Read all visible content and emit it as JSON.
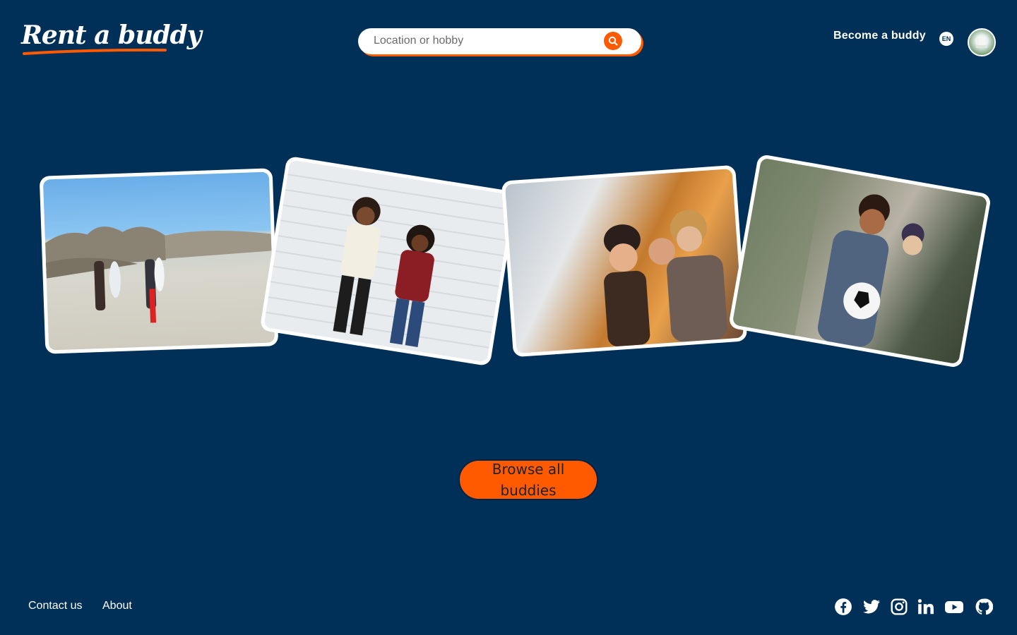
{
  "header": {
    "logo_text": "Rent a buddy",
    "search_placeholder": "Location or hobby",
    "become_buddy_label": "Become a buddy",
    "language": "EN",
    "search_icon": "search-icon",
    "avatar_icon": "user-avatar"
  },
  "gallery": {
    "images": [
      {
        "name": "beach-surfers-photo"
      },
      {
        "name": "two-friends-laughing-photo"
      },
      {
        "name": "group-of-friends-photo"
      },
      {
        "name": "man-with-soccer-ball-photo"
      }
    ]
  },
  "main": {
    "cta_label": "Browse all buddies"
  },
  "footer": {
    "links": [
      "Contact us",
      "About"
    ],
    "social_icons": [
      "facebook-icon",
      "twitter-icon",
      "instagram-icon",
      "linkedin-icon",
      "youtube-icon",
      "github-icon"
    ]
  },
  "colors": {
    "background": "#003057",
    "accent": "#ff5a00",
    "text": "#ffffff"
  }
}
